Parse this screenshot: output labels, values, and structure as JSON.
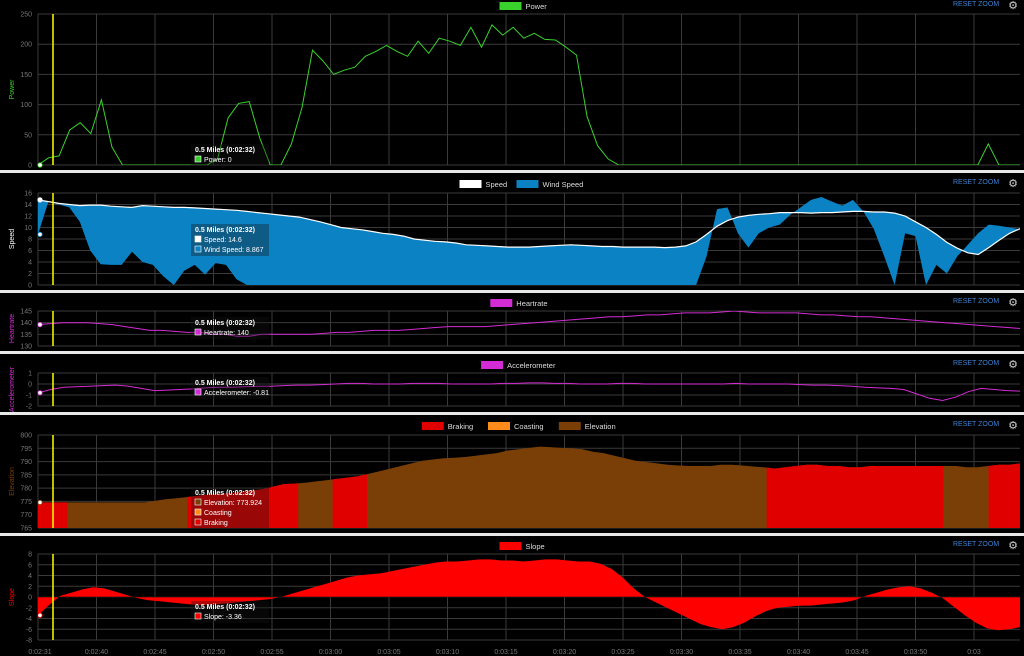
{
  "reset_label": "RESET ZOOM",
  "tooltip_title": "0.5 Miles (0:02:32)",
  "colors": {
    "grid": "#3a3a3a",
    "cursor": "#ffff00",
    "power": "#39d12c",
    "speed": "#ffffff",
    "wind": "#0b82c4",
    "heartrate": "#d42cd4",
    "accel": "#d42cd4",
    "braking": "#e00000",
    "coasting": "#ff8c1a",
    "elevation": "#7a3f06",
    "slope": "#ff0000"
  },
  "time_ticks": [
    "0:02:31",
    "0:02:40",
    "0:02:45",
    "0:02:50",
    "0:02:55",
    "0:03:00",
    "0:03:05",
    "0:03:10",
    "0:03:15",
    "0:03:20",
    "0:03:25",
    "0:03:30",
    "0:03:35",
    "0:03:40",
    "0:03:45",
    "0:03:50",
    "0:03"
  ],
  "chart_data": [
    {
      "id": "power",
      "type": "line",
      "legend": [
        "Power"
      ],
      "ylabel": "Power",
      "yticks": [
        "250",
        "200",
        "150",
        "100",
        "50",
        "0"
      ],
      "ylim": [
        0,
        250
      ],
      "tooltip": [
        {
          "label": "Power: 0"
        }
      ],
      "series": [
        {
          "name": "Power",
          "values": [
            0,
            12,
            15,
            58,
            70,
            52,
            108,
            30,
            0,
            0,
            0,
            0,
            0,
            0,
            0,
            0,
            0,
            10,
            78,
            102,
            105,
            45,
            0,
            0,
            35,
            95,
            190,
            172,
            150,
            157,
            162,
            180,
            188,
            198,
            188,
            180,
            205,
            185,
            210,
            205,
            198,
            228,
            195,
            232,
            215,
            228,
            210,
            218,
            208,
            207,
            195,
            182,
            80,
            32,
            10,
            0,
            0,
            0,
            0,
            0,
            0,
            0,
            0,
            0,
            0,
            0,
            0,
            0,
            0,
            0,
            0,
            0,
            0,
            0,
            0,
            0,
            0,
            0,
            0,
            0,
            0,
            0,
            0,
            0,
            0,
            0,
            0,
            0,
            0,
            0,
            35,
            0,
            0,
            0
          ]
        }
      ]
    },
    {
      "id": "speed",
      "type": "area",
      "legend": [
        "Speed",
        "Wind Speed"
      ],
      "ylabel": "Speed",
      "yticks": [
        "16",
        "14",
        "12",
        "10",
        "8",
        "6",
        "4",
        "2",
        "0"
      ],
      "ylim": [
        0,
        16
      ],
      "tooltip": [
        {
          "label": "Speed: 14.6"
        },
        {
          "label": "Wind Speed: 8.867"
        }
      ],
      "series": [
        {
          "name": "Speed",
          "values": [
            14.8,
            14.5,
            14.2,
            14.0,
            13.8,
            13.9,
            13.9,
            13.7,
            13.6,
            13.5,
            13.8,
            13.7,
            13.6,
            13.5,
            13.5,
            13.4,
            13.3,
            13.2,
            13.1,
            13.0,
            12.8,
            12.6,
            12.4,
            12.2,
            12.0,
            11.8,
            11.4,
            11.0,
            10.5,
            10.0,
            9.8,
            9.6,
            9.3,
            9.0,
            8.8,
            8.5,
            8.0,
            7.8,
            7.6,
            7.5,
            7.3,
            7.0,
            6.9,
            6.8,
            6.7,
            6.6,
            6.6,
            6.6,
            6.7,
            6.8,
            6.9,
            7.0,
            6.9,
            6.8,
            6.7,
            6.7,
            6.6,
            6.6,
            6.6,
            6.6,
            6.5,
            6.6,
            6.8,
            7.5,
            8.8,
            10.2,
            11.2,
            11.8,
            12.1,
            12.3,
            12.4,
            12.6,
            12.6,
            12.6,
            12.5,
            12.6,
            12.6,
            12.7,
            12.8,
            12.8,
            12.7,
            12.7,
            12.5,
            12.0,
            11.0,
            10.0,
            8.8,
            7.4,
            6.4,
            5.6,
            5.3,
            6.5,
            7.8,
            9.0,
            9.8
          ]
        },
        {
          "name": "Wind Speed",
          "values": [
            8.8,
            14.5,
            14.0,
            13.5,
            11.0,
            6.0,
            3.6,
            3.5,
            3.5,
            5.8,
            4.0,
            3.5,
            1.5,
            0.0,
            2.5,
            3.5,
            1.8,
            3.8,
            3.5,
            1.0,
            0.0,
            0.0,
            0.0,
            0.0,
            0.0,
            0.0,
            0.0,
            0.0,
            0.0,
            0.0,
            0.0,
            0.0,
            0.0,
            0.0,
            0.0,
            0.0,
            0.0,
            0.0,
            0.0,
            0.0,
            0.0,
            0.0,
            0.0,
            0.0,
            0.0,
            0.0,
            0.0,
            0.0,
            0.0,
            0.0,
            0.0,
            0.0,
            0.0,
            0.0,
            0.0,
            0.0,
            0.0,
            0.0,
            0.0,
            0.0,
            0.0,
            0.0,
            0.0,
            0.0,
            5.0,
            13.2,
            13.5,
            9.0,
            6.5,
            9.0,
            10.0,
            10.5,
            12.2,
            13.5,
            14.8,
            15.3,
            14.5,
            13.8,
            14.8,
            12.8,
            9.8,
            5.0,
            0.0,
            9.0,
            8.5,
            0.0,
            3.5,
            2.0,
            5.0,
            7.0,
            9.0,
            10.5,
            10.3,
            10.0,
            9.7
          ]
        }
      ]
    },
    {
      "id": "heartrate",
      "type": "line",
      "legend": [
        "Heartrate"
      ],
      "ylabel": "Heartrate",
      "yticks": [
        "145",
        "140",
        "135",
        "130"
      ],
      "ylim": [
        129,
        147
      ],
      "tooltip": [
        {
          "label": "Heartrate: 140"
        }
      ],
      "series": [
        {
          "name": "Heartrate",
          "values": [
            140,
            140.5,
            141,
            141,
            141,
            140.5,
            140,
            139,
            138,
            137,
            137,
            136.5,
            136,
            136,
            135,
            135,
            134,
            134,
            135,
            135,
            135,
            135,
            135,
            135.5,
            136,
            136,
            136.5,
            137,
            137,
            137,
            137.5,
            138,
            138.5,
            139,
            139,
            139,
            139,
            139.5,
            140,
            140.5,
            141,
            141.5,
            142,
            142.5,
            143,
            143.5,
            144,
            144,
            144.5,
            145,
            145,
            145.5,
            146,
            146,
            146,
            146.5,
            147,
            146.5,
            146,
            146,
            146,
            146,
            145.5,
            145,
            145,
            144.5,
            144,
            144,
            143.5,
            143,
            142.5,
            142,
            141.5,
            141,
            140.5,
            140,
            139.5,
            139,
            138.5,
            138
          ]
        }
      ]
    },
    {
      "id": "accelerometer",
      "type": "line",
      "legend": [
        "Accelerometer"
      ],
      "ylabel": "Accelerometer",
      "yticks": [
        "1",
        "0",
        "-1",
        "-2"
      ],
      "ylim": [
        -2,
        1
      ],
      "tooltip": [
        {
          "label": "Accelerometer: -0.81"
        }
      ],
      "series": [
        {
          "name": "Accelerometer",
          "values": [
            -0.8,
            -0.5,
            -0.3,
            -0.25,
            -0.2,
            -0.15,
            -0.1,
            -0.2,
            -0.4,
            -0.6,
            -0.55,
            -0.5,
            -0.45,
            -0.35,
            -0.3,
            -0.3,
            -0.25,
            -0.2,
            -0.2,
            -0.15,
            -0.1,
            -0.1,
            -0.05,
            0.0,
            0.05,
            0.05,
            0.0,
            0.0,
            0.0,
            0.05,
            0.05,
            0.05,
            0.0,
            0.0,
            0.0,
            0.0,
            0.05,
            0.05,
            0.1,
            0.1,
            0.05,
            0.05,
            0.0,
            0.0,
            0.0,
            0.05,
            0.05,
            0.0,
            0.0,
            0.0,
            0.0,
            0.0,
            0.0,
            0.0,
            0.05,
            0.0,
            0.0,
            0.0,
            0.0,
            -0.05,
            -0.1,
            -0.1,
            -0.15,
            -0.2,
            -0.3,
            -0.35,
            -0.4,
            -0.5,
            -0.9,
            -1.3,
            -1.5,
            -1.2,
            -0.7,
            -0.4,
            -0.5,
            -0.6,
            -0.65
          ]
        }
      ]
    },
    {
      "id": "elevation",
      "type": "area",
      "legend": [
        "Braking",
        "Coasting",
        "Elevation"
      ],
      "ylabel": "Elevation",
      "yticks": [
        "800",
        "795",
        "790",
        "785",
        "780",
        "775",
        "770",
        "765"
      ],
      "ylim": [
        764,
        800
      ],
      "tooltip": [
        {
          "label": "Elevation: 773.924"
        },
        {
          "label": "Coasting"
        },
        {
          "label": "Braking"
        }
      ],
      "braking_segments": [
        [
          0,
          0.03
        ],
        [
          0.152,
          0.265
        ],
        [
          0.3,
          0.335
        ],
        [
          0.742,
          0.922
        ],
        [
          0.968,
          1.0
        ]
      ],
      "series": [
        {
          "name": "Elevation",
          "values": [
            773.9,
            773.9,
            773.9,
            773.9,
            773.9,
            773.9,
            773.9,
            773.9,
            773.9,
            773.9,
            773.9,
            774.5,
            775.2,
            775.5,
            776,
            776.5,
            777,
            777.2,
            777.5,
            778,
            778.5,
            779,
            780,
            781,
            781.2,
            781.5,
            782,
            782.5,
            783,
            783.5,
            784,
            785,
            786,
            787,
            788,
            789,
            790,
            790.5,
            791,
            791.2,
            791.5,
            792,
            792.5,
            793,
            794,
            794.5,
            795,
            795.5,
            795.3,
            795,
            794.8,
            794.5,
            793.5,
            793,
            792,
            791,
            790,
            789.5,
            789,
            788.5,
            788.2,
            788,
            788,
            788,
            788.5,
            788.5,
            788.2,
            787.8,
            787.5,
            787,
            787.5,
            788,
            788.5,
            788.5,
            788,
            788,
            787.5,
            787.5,
            788,
            788,
            788,
            788,
            788,
            788,
            788,
            788,
            788,
            787.5,
            787.5,
            788,
            788.5,
            788.5,
            789
          ]
        }
      ]
    },
    {
      "id": "slope",
      "type": "area",
      "legend": [
        "Slope"
      ],
      "ylabel": "Slope",
      "yticks": [
        "8",
        "6",
        "4",
        "2",
        "0",
        "-2",
        "-4",
        "-6",
        "-8"
      ],
      "ylim": [
        -8,
        8
      ],
      "tooltip": [
        {
          "label": "Slope: -3.36"
        }
      ],
      "series": [
        {
          "name": "Slope",
          "values": [
            -3.4,
            -1.5,
            0.2,
            0.8,
            1.4,
            1.8,
            1.6,
            1.0,
            0.4,
            -0.2,
            -0.6,
            -0.8,
            -1.0,
            -1.2,
            -1.4,
            -1.5,
            -1.4,
            -1.2,
            -1.0,
            -0.8,
            -0.6,
            -0.4,
            0.0,
            0.6,
            1.2,
            1.8,
            2.4,
            3.0,
            3.6,
            4.0,
            4.2,
            4.4,
            4.8,
            5.2,
            5.6,
            6.0,
            6.4,
            6.6,
            6.6,
            6.8,
            7.0,
            7.0,
            6.8,
            6.8,
            6.6,
            6.8,
            7.0,
            7.0,
            6.8,
            6.6,
            6.6,
            6.2,
            5.2,
            3.6,
            1.6,
            0.0,
            -1.0,
            -2.0,
            -3.0,
            -4.0,
            -5.0,
            -5.6,
            -6.0,
            -5.6,
            -4.8,
            -3.6,
            -2.6,
            -2.0,
            -1.8,
            -1.6,
            -1.6,
            -1.4,
            -1.2,
            -1.0,
            -0.6,
            0.2,
            0.8,
            1.4,
            1.8,
            2.0,
            1.6,
            0.8,
            -0.2,
            -1.8,
            -3.4,
            -4.8,
            -5.8,
            -6.2,
            -6.0,
            -5.6
          ]
        }
      ]
    }
  ]
}
